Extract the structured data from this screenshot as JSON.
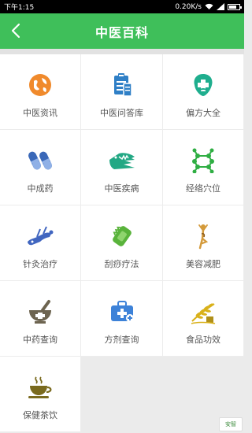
{
  "status_bar": {
    "time": "下午1:15",
    "network_speed": "0.20K/s",
    "battery_level": 0.75
  },
  "header": {
    "title": "中医百科",
    "back_icon": "chevron-left-icon",
    "background_color": "#3fbf5a"
  },
  "grid": {
    "items": [
      {
        "label": "中医资讯",
        "icon": "globe-icon",
        "color": "#f08a2c"
      },
      {
        "label": "中医问答库",
        "icon": "clipboard-icon",
        "color": "#2f7fc6"
      },
      {
        "label": "偏方大全",
        "icon": "medical-cross-icon",
        "color": "#1fae8e"
      },
      {
        "label": "中成药",
        "icon": "pills-icon",
        "color": "#3a68b8"
      },
      {
        "label": "中医疾病",
        "icon": "crocodile-icon",
        "color": "#22a884"
      },
      {
        "label": "经络穴位",
        "icon": "molecule-icon",
        "color": "#2fae43"
      },
      {
        "label": "针灸治疗",
        "icon": "acupuncture-icon",
        "color": "#4166c0"
      },
      {
        "label": "刮痧疗法",
        "icon": "scraper-icon",
        "color": "#59b33b"
      },
      {
        "label": "美容减肥",
        "icon": "yoga-icon",
        "color": "#d49a3a"
      },
      {
        "label": "中药查询",
        "icon": "mortar-pestle-icon",
        "color": "#6d6450"
      },
      {
        "label": "方剂查询",
        "icon": "medicine-bag-icon",
        "color": "#3d82d8"
      },
      {
        "label": "食品功效",
        "icon": "grain-icon",
        "color": "#d9b11a"
      },
      {
        "label": "保健茶饮",
        "icon": "tea-cup-icon",
        "color": "#7a6a1e"
      }
    ]
  },
  "watermark": {
    "text": "安智"
  }
}
